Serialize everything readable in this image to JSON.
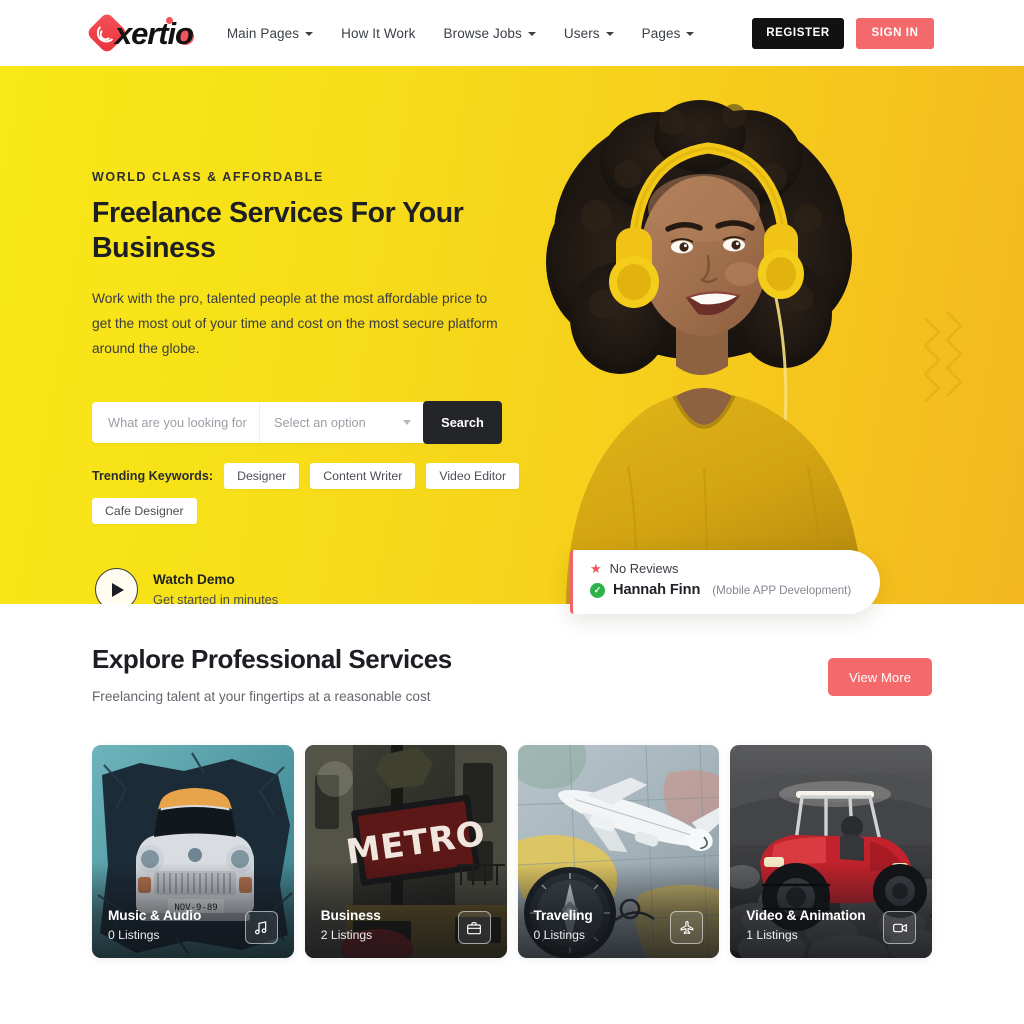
{
  "header": {
    "logo_text": "xertio",
    "nav": [
      {
        "label": "Main Pages",
        "has_dropdown": true
      },
      {
        "label": "How It Work",
        "has_dropdown": false
      },
      {
        "label": "Browse Jobs",
        "has_dropdown": true
      },
      {
        "label": "Users",
        "has_dropdown": true
      },
      {
        "label": "Pages",
        "has_dropdown": true
      }
    ],
    "register_label": "REGISTER",
    "signin_label": "SIGN IN"
  },
  "hero": {
    "eyebrow": "WORLD CLASS & AFFORDABLE",
    "title": "Freelance Services For Your Business",
    "subtitle": "Work with the pro, talented people at the most affordable price to get the most out of your time and cost on the most secure platform around the globe.",
    "search": {
      "input_placeholder": "What are you looking for",
      "select_placeholder": "Select an option",
      "button_label": "Search"
    },
    "trending": {
      "label": "Trending Keywords:",
      "chips": [
        "Designer",
        "Content Writer",
        "Video Editor",
        "Cafe Designer"
      ]
    },
    "watch_demo": {
      "title": "Watch Demo",
      "subtitle": "Get started in minutes",
      "icon": "play-icon"
    },
    "review_card": {
      "reviews_text": "No Reviews",
      "star_icon": "star-icon",
      "verified_icon": "check-circle-icon",
      "name": "Hannah Finn",
      "role": "(Mobile APP Development)"
    }
  },
  "services": {
    "title": "Explore Professional Services",
    "subtitle": "Freelancing talent at your fingertips at a reasonable cost",
    "view_more_label": "View More",
    "cards": [
      {
        "name": "Music & Audio",
        "count": "0 Listings",
        "icon": "music-note-icon"
      },
      {
        "name": "Business",
        "count": "2 Listings",
        "icon": "briefcase-icon"
      },
      {
        "name": "Traveling",
        "count": "0 Listings",
        "icon": "airplane-icon"
      },
      {
        "name": "Video & Animation",
        "count": "1 Listings",
        "icon": "video-camera-icon"
      }
    ]
  },
  "colors": {
    "accent_coral": "#f4696c",
    "hero_yellow_start": "#f8e817",
    "hero_yellow_end": "#f4b71f",
    "dark": "#232529",
    "verified_green": "#2fb24c"
  }
}
